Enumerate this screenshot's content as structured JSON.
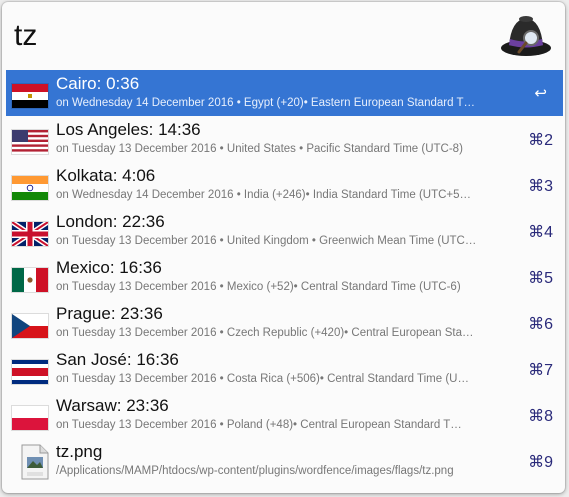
{
  "search": {
    "query": "tz"
  },
  "results": [
    {
      "flag": "egypt",
      "title": "Cairo: 0:36",
      "subtitle": "on Wednesday 14 December 2016  •  Egypt (+20)• Eastern European Standard T…",
      "shortcut": "↩",
      "selected": true
    },
    {
      "flag": "usa",
      "title": "Los Angeles: 14:36",
      "subtitle": "on Tuesday 13 December 2016  •  United States • Pacific Standard Time (UTC-8)",
      "shortcut": "⌘2"
    },
    {
      "flag": "india",
      "title": "Kolkata: 4:06",
      "subtitle": "on Wednesday 14 December 2016  •  India (+246)• India Standard Time (UTC+5…",
      "shortcut": "⌘3"
    },
    {
      "flag": "uk",
      "title": "London: 22:36",
      "subtitle": "on Tuesday 13 December 2016  •  United Kingdom • Greenwich Mean Time (UTC…",
      "shortcut": "⌘4"
    },
    {
      "flag": "mexico",
      "title": "Mexico: 16:36",
      "subtitle": "on Tuesday 13 December 2016  •  Mexico (+52)• Central Standard Time (UTC-6)",
      "shortcut": "⌘5"
    },
    {
      "flag": "czech",
      "title": "Prague: 23:36",
      "subtitle": "on Tuesday 13 December 2016  •  Czech Republic (+420)• Central European Sta…",
      "shortcut": "⌘6"
    },
    {
      "flag": "costarica",
      "title": "San José: 16:36",
      "subtitle": "on Tuesday 13 December 2016  •  Costa Rica (+506)• Central Standard Time (U…",
      "shortcut": "⌘7"
    },
    {
      "flag": "poland",
      "title": "Warsaw: 23:36",
      "subtitle": "on Tuesday 13 December 2016  •  Poland (+48)• Central European Standard T…",
      "shortcut": "⌘8"
    },
    {
      "flag": "png-file",
      "title": "tz.png",
      "subtitle": "/Applications/MAMP/htdocs/wp-content/plugins/wordfence/images/flags/tz.png",
      "shortcut": "⌘9"
    }
  ]
}
